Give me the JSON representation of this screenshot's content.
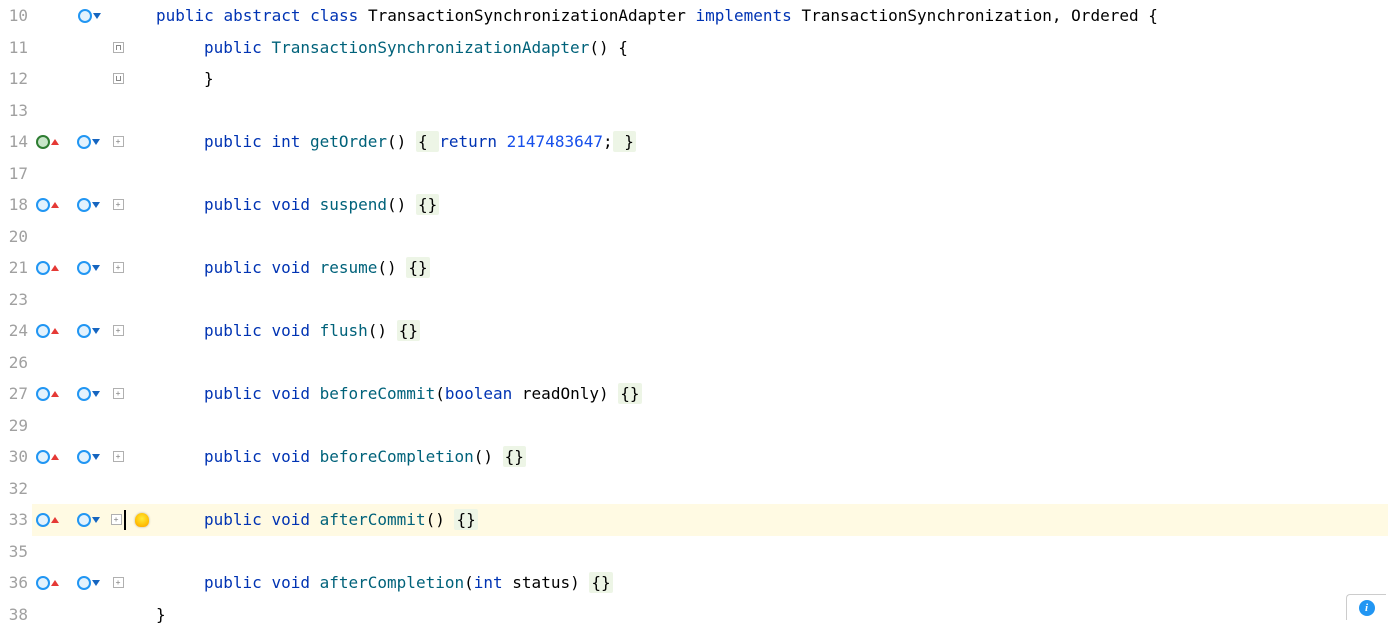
{
  "colors": {
    "keyword": "#0033B3",
    "identifier": "#00627A",
    "number": "#1750EB",
    "literal_bg": "#edf5e6",
    "highlight_bg": "#fffae3"
  },
  "fold_plus": "+",
  "lines": [
    {
      "num": "10",
      "marks": {
        "left": null,
        "right": "down"
      },
      "fold": "line",
      "bulb": false,
      "highlight": false,
      "tokens": [
        {
          "t": "public",
          "c": "kw"
        },
        {
          "t": " "
        },
        {
          "t": "abstract",
          "c": "kw"
        },
        {
          "t": " "
        },
        {
          "t": "class",
          "c": "kw"
        },
        {
          "t": " "
        },
        {
          "t": "TransactionSynchronizationAdapter",
          "c": "text-dark"
        },
        {
          "t": " "
        },
        {
          "t": "implements",
          "c": "kw"
        },
        {
          "t": " "
        },
        {
          "t": "TransactionSynchronization",
          "c": "text-dark"
        },
        {
          "t": ", "
        },
        {
          "t": "Ordered",
          "c": "text-dark"
        },
        {
          "t": " {"
        }
      ]
    },
    {
      "num": "11",
      "marks": {
        "left": null,
        "right": null
      },
      "fold": "open",
      "bulb": false,
      "highlight": false,
      "indent": 4,
      "tokens": [
        {
          "t": "public",
          "c": "kw"
        },
        {
          "t": " "
        },
        {
          "t": "TransactionSynchronizationAdapter",
          "c": "ident"
        },
        {
          "t": "() {"
        }
      ]
    },
    {
      "num": "12",
      "marks": {
        "left": null,
        "right": null
      },
      "fold": "close",
      "bulb": false,
      "highlight": false,
      "indent": 4,
      "tokens": [
        {
          "t": "}"
        }
      ]
    },
    {
      "num": "13",
      "marks": {
        "left": null,
        "right": null
      },
      "fold": "line",
      "bulb": false,
      "highlight": false,
      "indent": 0,
      "tokens": []
    },
    {
      "num": "14",
      "marks": {
        "left": "green-up",
        "right": "down"
      },
      "fold": "plus",
      "bulb": false,
      "highlight": false,
      "indent": 4,
      "tokens": [
        {
          "t": "public",
          "c": "kw"
        },
        {
          "t": " "
        },
        {
          "t": "int",
          "c": "kw"
        },
        {
          "t": " "
        },
        {
          "t": "getOrder",
          "c": "ident"
        },
        {
          "t": "() "
        },
        {
          "t": "{ ",
          "c": "brace-bg"
        },
        {
          "t": "return",
          "c": "kw"
        },
        {
          "t": " "
        },
        {
          "t": "2147483647",
          "c": "num"
        },
        {
          "t": ";"
        },
        {
          "t": " }",
          "c": "brace-bg"
        }
      ]
    },
    {
      "num": "17",
      "marks": {
        "left": null,
        "right": null
      },
      "fold": "line",
      "bulb": false,
      "highlight": false,
      "indent": 0,
      "tokens": []
    },
    {
      "num": "18",
      "marks": {
        "left": "blue-up",
        "right": "down"
      },
      "fold": "plus",
      "bulb": false,
      "highlight": false,
      "indent": 4,
      "tokens": [
        {
          "t": "public",
          "c": "kw"
        },
        {
          "t": " "
        },
        {
          "t": "void",
          "c": "kw"
        },
        {
          "t": " "
        },
        {
          "t": "suspend",
          "c": "ident"
        },
        {
          "t": "() "
        },
        {
          "t": "{}",
          "c": "brace-bg"
        }
      ]
    },
    {
      "num": "20",
      "marks": {
        "left": null,
        "right": null
      },
      "fold": "line",
      "bulb": false,
      "highlight": false,
      "indent": 0,
      "tokens": []
    },
    {
      "num": "21",
      "marks": {
        "left": "blue-up",
        "right": "down"
      },
      "fold": "plus",
      "bulb": false,
      "highlight": false,
      "indent": 4,
      "tokens": [
        {
          "t": "public",
          "c": "kw"
        },
        {
          "t": " "
        },
        {
          "t": "void",
          "c": "kw"
        },
        {
          "t": " "
        },
        {
          "t": "resume",
          "c": "ident"
        },
        {
          "t": "() "
        },
        {
          "t": "{}",
          "c": "brace-bg"
        }
      ]
    },
    {
      "num": "23",
      "marks": {
        "left": null,
        "right": null
      },
      "fold": "line",
      "bulb": false,
      "highlight": false,
      "indent": 0,
      "tokens": []
    },
    {
      "num": "24",
      "marks": {
        "left": "blue-up",
        "right": "down"
      },
      "fold": "plus",
      "bulb": false,
      "highlight": false,
      "indent": 4,
      "tokens": [
        {
          "t": "public",
          "c": "kw"
        },
        {
          "t": " "
        },
        {
          "t": "void",
          "c": "kw"
        },
        {
          "t": " "
        },
        {
          "t": "flush",
          "c": "ident"
        },
        {
          "t": "() "
        },
        {
          "t": "{}",
          "c": "brace-bg"
        }
      ]
    },
    {
      "num": "26",
      "marks": {
        "left": null,
        "right": null
      },
      "fold": "line",
      "bulb": false,
      "highlight": false,
      "indent": 0,
      "tokens": []
    },
    {
      "num": "27",
      "marks": {
        "left": "blue-up",
        "right": "down"
      },
      "fold": "plus",
      "bulb": false,
      "highlight": false,
      "indent": 4,
      "tokens": [
        {
          "t": "public",
          "c": "kw"
        },
        {
          "t": " "
        },
        {
          "t": "void",
          "c": "kw"
        },
        {
          "t": " "
        },
        {
          "t": "beforeCommit",
          "c": "ident"
        },
        {
          "t": "("
        },
        {
          "t": "boolean",
          "c": "kw"
        },
        {
          "t": " readOnly) "
        },
        {
          "t": "{}",
          "c": "brace-bg"
        }
      ]
    },
    {
      "num": "29",
      "marks": {
        "left": null,
        "right": null
      },
      "fold": "line",
      "bulb": false,
      "highlight": false,
      "indent": 0,
      "tokens": []
    },
    {
      "num": "30",
      "marks": {
        "left": "blue-up",
        "right": "down"
      },
      "fold": "plus",
      "bulb": false,
      "highlight": false,
      "indent": 4,
      "tokens": [
        {
          "t": "public",
          "c": "kw"
        },
        {
          "t": " "
        },
        {
          "t": "void",
          "c": "kw"
        },
        {
          "t": " "
        },
        {
          "t": "beforeCompletion",
          "c": "ident"
        },
        {
          "t": "() "
        },
        {
          "t": "{}",
          "c": "brace-bg"
        }
      ]
    },
    {
      "num": "32",
      "marks": {
        "left": null,
        "right": null
      },
      "fold": "line",
      "bulb": false,
      "highlight": false,
      "indent": 0,
      "tokens": []
    },
    {
      "num": "33",
      "marks": {
        "left": "blue-up",
        "right": "down"
      },
      "fold": "plus-caret",
      "bulb": true,
      "highlight": true,
      "indent": 4,
      "tokens": [
        {
          "t": "public",
          "c": "kw"
        },
        {
          "t": " "
        },
        {
          "t": "void",
          "c": "kw"
        },
        {
          "t": " "
        },
        {
          "t": "afterCommit",
          "c": "ident"
        },
        {
          "t": "() "
        },
        {
          "t": "{}",
          "c": "brace-bg"
        }
      ]
    },
    {
      "num": "35",
      "marks": {
        "left": null,
        "right": null
      },
      "fold": "line",
      "bulb": false,
      "highlight": false,
      "indent": 0,
      "tokens": []
    },
    {
      "num": "36",
      "marks": {
        "left": "blue-up",
        "right": "down"
      },
      "fold": "plus",
      "bulb": false,
      "highlight": false,
      "indent": 4,
      "tokens": [
        {
          "t": "public",
          "c": "kw"
        },
        {
          "t": " "
        },
        {
          "t": "void",
          "c": "kw"
        },
        {
          "t": " "
        },
        {
          "t": "afterCompletion",
          "c": "ident"
        },
        {
          "t": "("
        },
        {
          "t": "int",
          "c": "kw"
        },
        {
          "t": " status) "
        },
        {
          "t": "{}",
          "c": "brace-bg"
        }
      ]
    },
    {
      "num": "38",
      "marks": {
        "left": null,
        "right": null
      },
      "fold": "line",
      "bulb": false,
      "highlight": false,
      "indent": 0,
      "tokens": [
        {
          "t": "}"
        }
      ]
    }
  ],
  "info_badge": "i"
}
